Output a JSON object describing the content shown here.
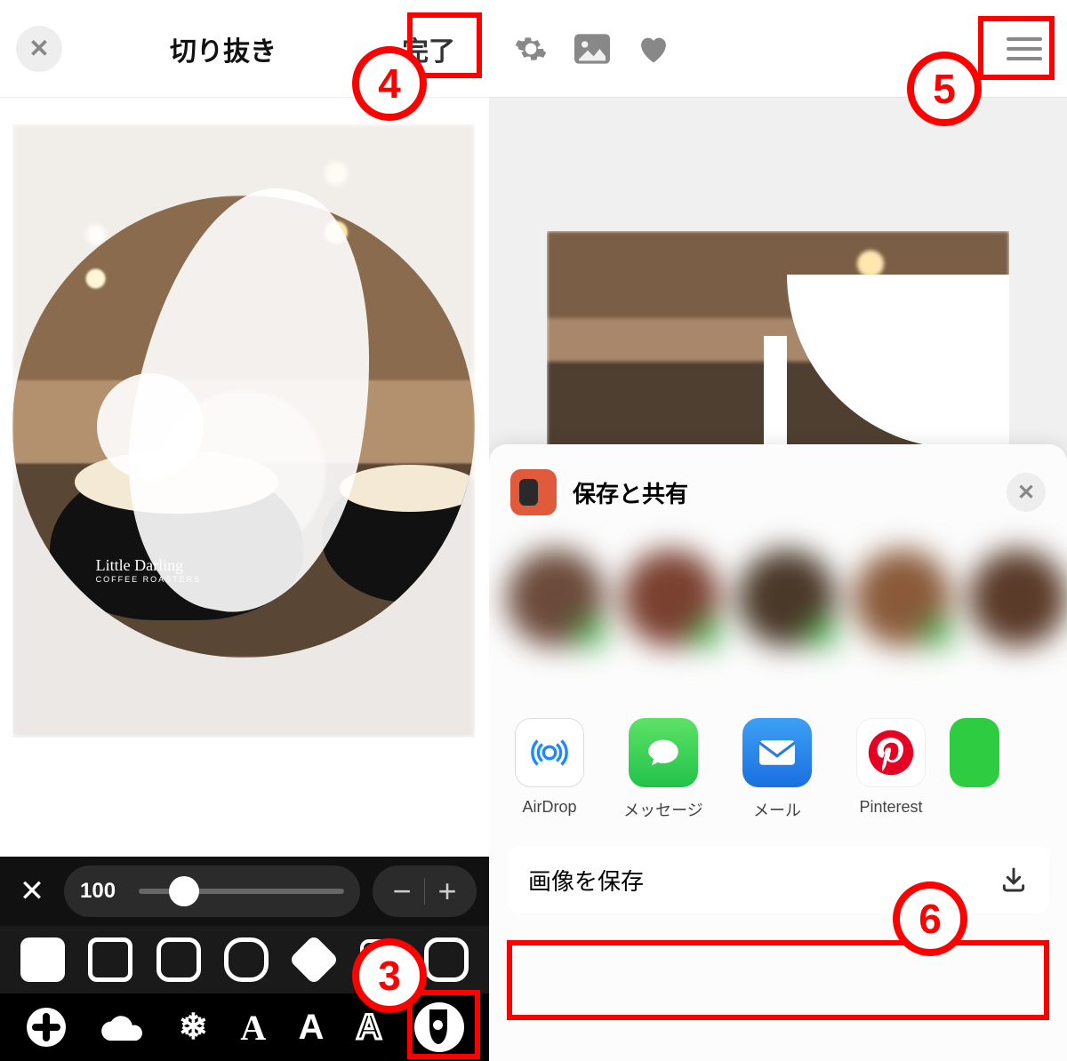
{
  "left": {
    "title": "切り抜き",
    "done": "完了",
    "slider_value": "100",
    "brand": "Little Darling",
    "brand_sub": "COFFEE ROASTERS"
  },
  "right": {
    "sheet_title": "保存と共有",
    "apps": [
      {
        "label": "AirDrop"
      },
      {
        "label": "メッセージ"
      },
      {
        "label": "メール"
      },
      {
        "label": "Pinterest"
      }
    ],
    "save_action": "画像を保存"
  },
  "callouts": {
    "c3": "3",
    "c4": "4",
    "c5": "5",
    "c6": "6"
  }
}
